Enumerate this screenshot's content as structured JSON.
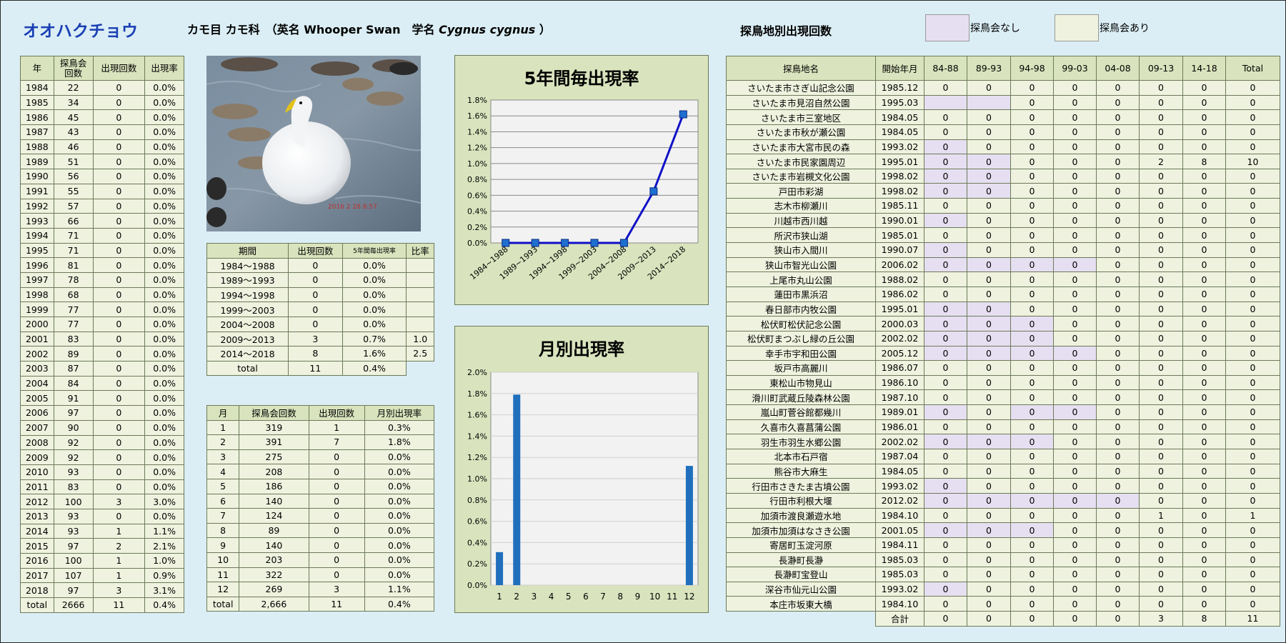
{
  "header": {
    "species": "オオハクチョウ",
    "order_family": "カモ目 カモ科",
    "en_prefix": "（英名",
    "en_name": "Whooper Swan",
    "sci_prefix": "学名",
    "sci_name": "Cygnus cygnus",
    "close": "）",
    "location_title": "探鳥地別出現回数",
    "legend_none": "探鳥会なし",
    "legend_has": "探鳥会あり"
  },
  "colors": {
    "no_event": "#e6dff1",
    "has_event": "#eef2de",
    "header": "#d9e3bd",
    "title": "#1a3fb4",
    "line": "#1010c8",
    "bar": "#1f6fbd"
  },
  "photo": {
    "stamp": "2016  2  28  8:57"
  },
  "year_table": {
    "headers": [
      "年",
      "探鳥会\n回数",
      "出現回数",
      "出現率"
    ],
    "rows": [
      [
        "1984",
        "22",
        "0",
        "0.0%"
      ],
      [
        "1985",
        "34",
        "0",
        "0.0%"
      ],
      [
        "1986",
        "45",
        "0",
        "0.0%"
      ],
      [
        "1987",
        "43",
        "0",
        "0.0%"
      ],
      [
        "1988",
        "46",
        "0",
        "0.0%"
      ],
      [
        "1989",
        "51",
        "0",
        "0.0%"
      ],
      [
        "1990",
        "56",
        "0",
        "0.0%"
      ],
      [
        "1991",
        "55",
        "0",
        "0.0%"
      ],
      [
        "1992",
        "57",
        "0",
        "0.0%"
      ],
      [
        "1993",
        "66",
        "0",
        "0.0%"
      ],
      [
        "1994",
        "71",
        "0",
        "0.0%"
      ],
      [
        "1995",
        "71",
        "0",
        "0.0%"
      ],
      [
        "1996",
        "81",
        "0",
        "0.0%"
      ],
      [
        "1997",
        "78",
        "0",
        "0.0%"
      ],
      [
        "1998",
        "68",
        "0",
        "0.0%"
      ],
      [
        "1999",
        "77",
        "0",
        "0.0%"
      ],
      [
        "2000",
        "77",
        "0",
        "0.0%"
      ],
      [
        "2001",
        "83",
        "0",
        "0.0%"
      ],
      [
        "2002",
        "89",
        "0",
        "0.0%"
      ],
      [
        "2003",
        "87",
        "0",
        "0.0%"
      ],
      [
        "2004",
        "84",
        "0",
        "0.0%"
      ],
      [
        "2005",
        "91",
        "0",
        "0.0%"
      ],
      [
        "2006",
        "97",
        "0",
        "0.0%"
      ],
      [
        "2007",
        "90",
        "0",
        "0.0%"
      ],
      [
        "2008",
        "92",
        "0",
        "0.0%"
      ],
      [
        "2009",
        "92",
        "0",
        "0.0%"
      ],
      [
        "2010",
        "93",
        "0",
        "0.0%"
      ],
      [
        "2011",
        "83",
        "0",
        "0.0%"
      ],
      [
        "2012",
        "100",
        "3",
        "3.0%"
      ],
      [
        "2013",
        "93",
        "0",
        "0.0%"
      ],
      [
        "2014",
        "93",
        "1",
        "1.1%"
      ],
      [
        "2015",
        "97",
        "2",
        "2.1%"
      ],
      [
        "2016",
        "100",
        "1",
        "1.0%"
      ],
      [
        "2017",
        "107",
        "1",
        "0.9%"
      ],
      [
        "2018",
        "97",
        "3",
        "3.1%"
      ]
    ],
    "total": [
      "total",
      "2666",
      "11",
      "0.4%"
    ]
  },
  "period_table": {
    "headers": [
      "期間",
      "出現回数",
      "5年間毎出現率",
      "比率"
    ],
    "rows": [
      [
        "1984～1988",
        "0",
        "0.0%",
        ""
      ],
      [
        "1989～1993",
        "0",
        "0.0%",
        ""
      ],
      [
        "1994～1998",
        "0",
        "0.0%",
        ""
      ],
      [
        "1999～2003",
        "0",
        "0.0%",
        ""
      ],
      [
        "2004～2008",
        "0",
        "0.0%",
        ""
      ],
      [
        "2009～2013",
        "3",
        "0.7%",
        "1.0"
      ],
      [
        "2014～2018",
        "8",
        "1.6%",
        "2.5"
      ]
    ],
    "total": [
      "total",
      "11",
      "0.4%"
    ]
  },
  "month_table": {
    "headers": [
      "月",
      "探鳥会回数",
      "出現回数",
      "月別出現率"
    ],
    "rows": [
      [
        "1",
        "319",
        "1",
        "0.3%"
      ],
      [
        "2",
        "391",
        "7",
        "1.8%"
      ],
      [
        "3",
        "275",
        "0",
        "0.0%"
      ],
      [
        "4",
        "208",
        "0",
        "0.0%"
      ],
      [
        "5",
        "186",
        "0",
        "0.0%"
      ],
      [
        "6",
        "140",
        "0",
        "0.0%"
      ],
      [
        "7",
        "124",
        "0",
        "0.0%"
      ],
      [
        "8",
        "89",
        "0",
        "0.0%"
      ],
      [
        "9",
        "140",
        "0",
        "0.0%"
      ],
      [
        "10",
        "203",
        "0",
        "0.0%"
      ],
      [
        "11",
        "322",
        "0",
        "0.0%"
      ],
      [
        "12",
        "269",
        "3",
        "1.1%"
      ]
    ],
    "total": [
      "total",
      "2,666",
      "11",
      "0.4%"
    ]
  },
  "chart_data": [
    {
      "type": "line",
      "title": "5年間毎出現率",
      "categories": [
        "1984~1988",
        "1989~1993",
        "1994~1998",
        "1999~2003",
        "2004~2008",
        "2009~2013",
        "2014~2018"
      ],
      "values": [
        0.0,
        0.0,
        0.0,
        0.0,
        0.0,
        0.65,
        1.62
      ],
      "ylim": [
        0,
        1.8
      ],
      "yticks": [
        "0.0%",
        "0.2%",
        "0.4%",
        "0.6%",
        "0.8%",
        "1.0%",
        "1.2%",
        "1.4%",
        "1.6%",
        "1.8%"
      ],
      "grid": true
    },
    {
      "type": "bar",
      "title": "月別出現率",
      "categories": [
        "1",
        "2",
        "3",
        "4",
        "5",
        "6",
        "7",
        "8",
        "9",
        "10",
        "11",
        "12"
      ],
      "values": [
        0.31,
        1.79,
        0,
        0,
        0,
        0,
        0,
        0,
        0,
        0,
        0,
        1.12
      ],
      "ylim": [
        0,
        2.0
      ],
      "yticks": [
        "0.0%",
        "0.2%",
        "0.4%",
        "0.6%",
        "0.8%",
        "1.0%",
        "1.2%",
        "1.4%",
        "1.6%",
        "1.8%",
        "2.0%"
      ],
      "grid": true
    }
  ],
  "location_table": {
    "headers": [
      "探鳥地名",
      "開始年月",
      "84-88",
      "89-93",
      "94-98",
      "99-03",
      "04-08",
      "09-13",
      "14-18",
      "Total"
    ],
    "rows": [
      {
        "name": "さいたま市さぎ山記念公園",
        "start": "1985.12",
        "v": [
          "0",
          "0",
          "0",
          "0",
          "0",
          "0",
          "0",
          "0"
        ],
        "n": []
      },
      {
        "name": "さいたま市見沼自然公園",
        "start": "1995.03",
        "v": [
          "",
          "",
          "0",
          "0",
          "0",
          "0",
          "0",
          "0"
        ],
        "n": [
          0,
          1
        ]
      },
      {
        "name": "さいたま市三室地区",
        "start": "1984.05",
        "v": [
          "0",
          "0",
          "0",
          "0",
          "0",
          "0",
          "0",
          "0"
        ],
        "n": []
      },
      {
        "name": "さいたま市秋が瀬公園",
        "start": "1984.05",
        "v": [
          "0",
          "0",
          "0",
          "0",
          "0",
          "0",
          "0",
          "0"
        ],
        "n": []
      },
      {
        "name": "さいたま市大宮市民の森",
        "start": "1993.02",
        "v": [
          "0",
          "0",
          "0",
          "0",
          "0",
          "0",
          "0",
          "0"
        ],
        "n": [
          0
        ]
      },
      {
        "name": "さいたま市民家園周辺",
        "start": "1995.01",
        "v": [
          "0",
          "0",
          "0",
          "0",
          "0",
          "2",
          "8",
          "10"
        ],
        "n": [
          0,
          1
        ]
      },
      {
        "name": "さいたま市岩槻文化公園",
        "start": "1998.02",
        "v": [
          "0",
          "0",
          "0",
          "0",
          "0",
          "0",
          "0",
          "0"
        ],
        "n": [
          0,
          1
        ]
      },
      {
        "name": "戸田市彩湖",
        "start": "1998.02",
        "v": [
          "0",
          "0",
          "0",
          "0",
          "0",
          "0",
          "0",
          "0"
        ],
        "n": [
          0,
          1
        ]
      },
      {
        "name": "志木市柳瀬川",
        "start": "1985.11",
        "v": [
          "0",
          "0",
          "0",
          "0",
          "0",
          "0",
          "0",
          "0"
        ],
        "n": []
      },
      {
        "name": "川越市西川越",
        "start": "1990.01",
        "v": [
          "0",
          "0",
          "0",
          "0",
          "0",
          "0",
          "0",
          "0"
        ],
        "n": [
          0
        ]
      },
      {
        "name": "所沢市狭山湖",
        "start": "1985.01",
        "v": [
          "0",
          "0",
          "0",
          "0",
          "0",
          "0",
          "0",
          "0"
        ],
        "n": []
      },
      {
        "name": "狭山市入間川",
        "start": "1990.07",
        "v": [
          "0",
          "0",
          "0",
          "0",
          "0",
          "0",
          "0",
          "0"
        ],
        "n": [
          0
        ]
      },
      {
        "name": "狭山市智光山公園",
        "start": "2006.02",
        "v": [
          "0",
          "0",
          "0",
          "0",
          "0",
          "0",
          "0",
          "0"
        ],
        "n": [
          0,
          1,
          2,
          3
        ]
      },
      {
        "name": "上尾市丸山公園",
        "start": "1988.02",
        "v": [
          "0",
          "0",
          "0",
          "0",
          "0",
          "0",
          "0",
          "0"
        ],
        "n": []
      },
      {
        "name": "蓮田市黒浜沼",
        "start": "1986.02",
        "v": [
          "0",
          "0",
          "0",
          "0",
          "0",
          "0",
          "0",
          "0"
        ],
        "n": []
      },
      {
        "name": "春日部市内牧公園",
        "start": "1995.01",
        "v": [
          "0",
          "0",
          "0",
          "0",
          "0",
          "0",
          "0",
          "0"
        ],
        "n": [
          0,
          1
        ]
      },
      {
        "name": "松伏町松伏記念公園",
        "start": "2000.03",
        "v": [
          "0",
          "0",
          "0",
          "0",
          "0",
          "0",
          "0",
          "0"
        ],
        "n": [
          0,
          1,
          2
        ]
      },
      {
        "name": "松伏町まつぶし緑の丘公園",
        "start": "2002.02",
        "v": [
          "0",
          "0",
          "0",
          "0",
          "0",
          "0",
          "0",
          "0"
        ],
        "n": [
          0,
          1,
          2
        ]
      },
      {
        "name": "幸手市宇和田公園",
        "start": "2005.12",
        "v": [
          "0",
          "0",
          "0",
          "0",
          "0",
          "0",
          "0",
          "0"
        ],
        "n": [
          0,
          1,
          2,
          3
        ]
      },
      {
        "name": "坂戸市高麗川",
        "start": "1986.07",
        "v": [
          "0",
          "0",
          "0",
          "0",
          "0",
          "0",
          "0",
          "0"
        ],
        "n": []
      },
      {
        "name": "東松山市物見山",
        "start": "1986.10",
        "v": [
          "0",
          "0",
          "0",
          "0",
          "0",
          "0",
          "0",
          "0"
        ],
        "n": []
      },
      {
        "name": "滑川町武蔵丘陵森林公園",
        "start": "1987.10",
        "v": [
          "0",
          "0",
          "0",
          "0",
          "0",
          "0",
          "0",
          "0"
        ],
        "n": []
      },
      {
        "name": "嵐山町菅谷館都幾川",
        "start": "1989.01",
        "v": [
          "0",
          "0",
          "0",
          "0",
          "0",
          "0",
          "0",
          "0"
        ],
        "n": [
          0,
          2,
          3
        ]
      },
      {
        "name": "久喜市久喜菖蒲公園",
        "start": "1986.01",
        "v": [
          "0",
          "0",
          "0",
          "0",
          "0",
          "0",
          "0",
          "0"
        ],
        "n": []
      },
      {
        "name": "羽生市羽生水郷公園",
        "start": "2002.02",
        "v": [
          "0",
          "0",
          "0",
          "0",
          "0",
          "0",
          "0",
          "0"
        ],
        "n": [
          0,
          1,
          2
        ]
      },
      {
        "name": "北本市石戸宿",
        "start": "1987.04",
        "v": [
          "0",
          "0",
          "0",
          "0",
          "0",
          "0",
          "0",
          "0"
        ],
        "n": []
      },
      {
        "name": "熊谷市大麻生",
        "start": "1984.05",
        "v": [
          "0",
          "0",
          "0",
          "0",
          "0",
          "0",
          "0",
          "0"
        ],
        "n": []
      },
      {
        "name": "行田市さきたま古墳公園",
        "start": "1993.02",
        "v": [
          "0",
          "0",
          "0",
          "0",
          "0",
          "0",
          "0",
          "0"
        ],
        "n": [
          0
        ]
      },
      {
        "name": "行田市利根大堰",
        "start": "2012.02",
        "v": [
          "0",
          "0",
          "0",
          "0",
          "0",
          "0",
          "0",
          "0"
        ],
        "n": [
          0,
          1,
          2,
          3,
          4
        ]
      },
      {
        "name": "加須市渡良瀬遊水地",
        "start": "1984.10",
        "v": [
          "0",
          "0",
          "0",
          "0",
          "0",
          "1",
          "0",
          "1"
        ],
        "n": []
      },
      {
        "name": "加須市加須はなさき公園",
        "start": "2001.05",
        "v": [
          "0",
          "0",
          "0",
          "0",
          "0",
          "0",
          "0",
          "0"
        ],
        "n": [
          0,
          1,
          2
        ]
      },
      {
        "name": "寄居町玉淀河原",
        "start": "1984.11",
        "v": [
          "0",
          "0",
          "0",
          "0",
          "0",
          "0",
          "0",
          "0"
        ],
        "n": []
      },
      {
        "name": "長瀞町長瀞",
        "start": "1985.03",
        "v": [
          "0",
          "0",
          "0",
          "0",
          "0",
          "0",
          "0",
          "0"
        ],
        "n": []
      },
      {
        "name": "長瀞町宝登山",
        "start": "1985.03",
        "v": [
          "0",
          "0",
          "0",
          "0",
          "0",
          "0",
          "0",
          "0"
        ],
        "n": []
      },
      {
        "name": "深谷市仙元山公園",
        "start": "1993.02",
        "v": [
          "0",
          "0",
          "0",
          "0",
          "0",
          "0",
          "0",
          "0"
        ],
        "n": [
          0
        ]
      },
      {
        "name": "本庄市坂東大橋",
        "start": "1984.10",
        "v": [
          "0",
          "0",
          "0",
          "0",
          "0",
          "0",
          "0",
          "0"
        ],
        "n": []
      }
    ],
    "total_label": "合計",
    "total": [
      "0",
      "0",
      "0",
      "0",
      "0",
      "3",
      "8",
      "11"
    ]
  }
}
